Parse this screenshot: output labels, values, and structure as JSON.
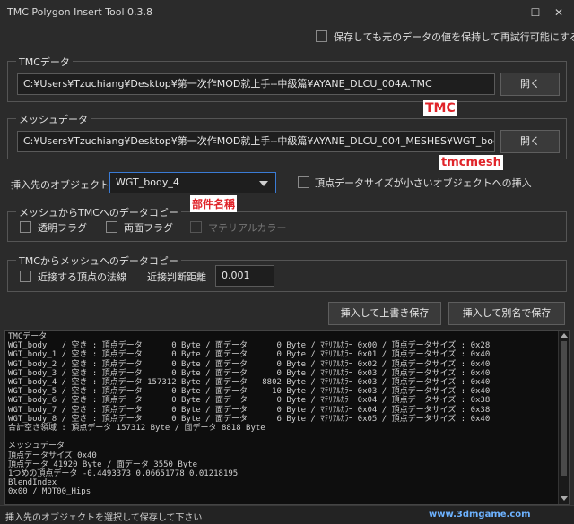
{
  "window": {
    "title": "TMC Polygon Insert Tool 0.3.8",
    "min_glyph": "—",
    "max_glyph": "☐",
    "close_glyph": "✕"
  },
  "top_option": {
    "label": "保存しても元のデータの値を保持して再試行可能にする"
  },
  "tmc_group": {
    "legend": "TMCデータ",
    "path": "C:¥Users¥Tzuchiang¥Desktop¥第一次作MOD就上手--中級篇¥AYANE_DLCU_004A.TMC",
    "open_label": "開く"
  },
  "mesh_group": {
    "legend": "メッシュデータ",
    "path": "C:¥Users¥Tzuchiang¥Desktop¥第一次作MOD就上手--中級篇¥AYANE_DLCU_004_MESHES¥WGT_body_4",
    "open_label": "開く"
  },
  "target": {
    "label": "挿入先のオブジェクト",
    "selected": "WGT_body_4",
    "small_insert_label": "頂点データサイズが小さいオブジェクトへの挿入"
  },
  "mesh_to_tmc": {
    "legend": "メッシュからTMCへのデータコピー",
    "opt1": "透明フラグ",
    "opt2": "両面フラグ",
    "opt3": "マテリアルカラー"
  },
  "tmc_to_mesh": {
    "legend": "TMCからメッシュへのデータコピー",
    "normal_label": "近接する頂点の法線",
    "threshold_label": "近接判断距離",
    "threshold_value": "0.001"
  },
  "actions": {
    "overwrite_label": "挿入して上書き保存",
    "saveas_label": "挿入して別名で保存"
  },
  "annotations": {
    "tmc": "TMC",
    "tmcmesh": "tmcmesh",
    "part": "部件名稱"
  },
  "log_text": "TMCデータ\nWGT_body   / 空き : 頂点データ      0 Byte / 面データ      0 Byte / ﾏﾃﾘｱﾙｶﾗｰ 0x00 / 頂点データサイズ : 0x28\nWGT_body_1 / 空き : 頂点データ      0 Byte / 面データ      0 Byte / ﾏﾃﾘｱﾙｶﾗｰ 0x01 / 頂点データサイズ : 0x40\nWGT_body_2 / 空き : 頂点データ      0 Byte / 面データ      0 Byte / ﾏﾃﾘｱﾙｶﾗｰ 0x02 / 頂点データサイズ : 0x40\nWGT_body_3 / 空き : 頂点データ      0 Byte / 面データ      0 Byte / ﾏﾃﾘｱﾙｶﾗｰ 0x03 / 頂点データサイズ : 0x40\nWGT_body_4 / 空き : 頂点データ 157312 Byte / 面データ   8802 Byte / ﾏﾃﾘｱﾙｶﾗｰ 0x03 / 頂点データサイズ : 0x40\nWGT_body_5 / 空き : 頂点データ      0 Byte / 面データ     10 Byte / ﾏﾃﾘｱﾙｶﾗｰ 0x03 / 頂点データサイズ : 0x40\nWGT_body_6 / 空き : 頂点データ      0 Byte / 面データ      0 Byte / ﾏﾃﾘｱﾙｶﾗｰ 0x04 / 頂点データサイズ : 0x38\nWGT_body_7 / 空き : 頂点データ      0 Byte / 面データ      0 Byte / ﾏﾃﾘｱﾙｶﾗｰ 0x04 / 頂点データサイズ : 0x38\nWGT_body_8 / 空き : 頂点データ      0 Byte / 面データ      6 Byte / ﾏﾃﾘｱﾙｶﾗｰ 0x05 / 頂点データサイズ : 0x40\n合計空き領域 : 頂点データ 157312 Byte / 面データ 8818 Byte\n\nメッシュデータ\n頂点データサイズ 0x40\n頂点データ 41920 Byte / 面データ 3550 Byte\n1つめの頂点データ -0.4493373 0.06651778 0.01218195\nBlendIndex\n0x00 / MOT00_Hips",
  "status": {
    "text": "挿入先のオブジェクトを選択して保存して下さい",
    "watermark": "www.3dmgame.com"
  }
}
